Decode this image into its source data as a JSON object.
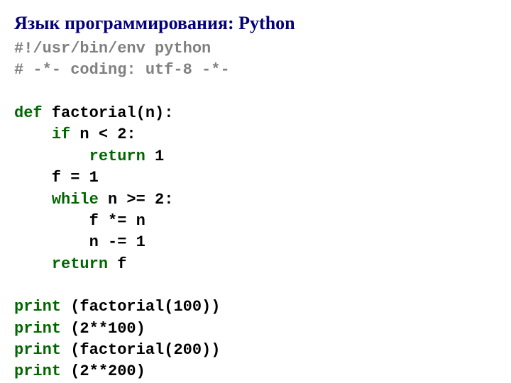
{
  "title": "Язык программирования: Python",
  "code": {
    "c1": "#!/usr/bin/env python",
    "c2": "# -*- coding: utf-8 -*-",
    "l1a": "def",
    "l1b": " factorial(n):",
    "l2a": "    ",
    "l2b": "if",
    "l2c": " n < 2:",
    "l3a": "        ",
    "l3b": "return",
    "l3c": " 1",
    "l4": "    f = 1",
    "l5a": "    ",
    "l5b": "while",
    "l5c": " n >= 2:",
    "l6": "        f *= n",
    "l7": "        n -= 1",
    "l8a": "    ",
    "l8b": "return",
    "l8c": " f",
    "p1a": "print",
    "p1b": " (factorial(100))",
    "p2a": "print",
    "p2b": " (2**100)",
    "p3a": "print",
    "p3b": " (factorial(200))",
    "p4a": "print",
    "p4b": " (2**200)"
  }
}
